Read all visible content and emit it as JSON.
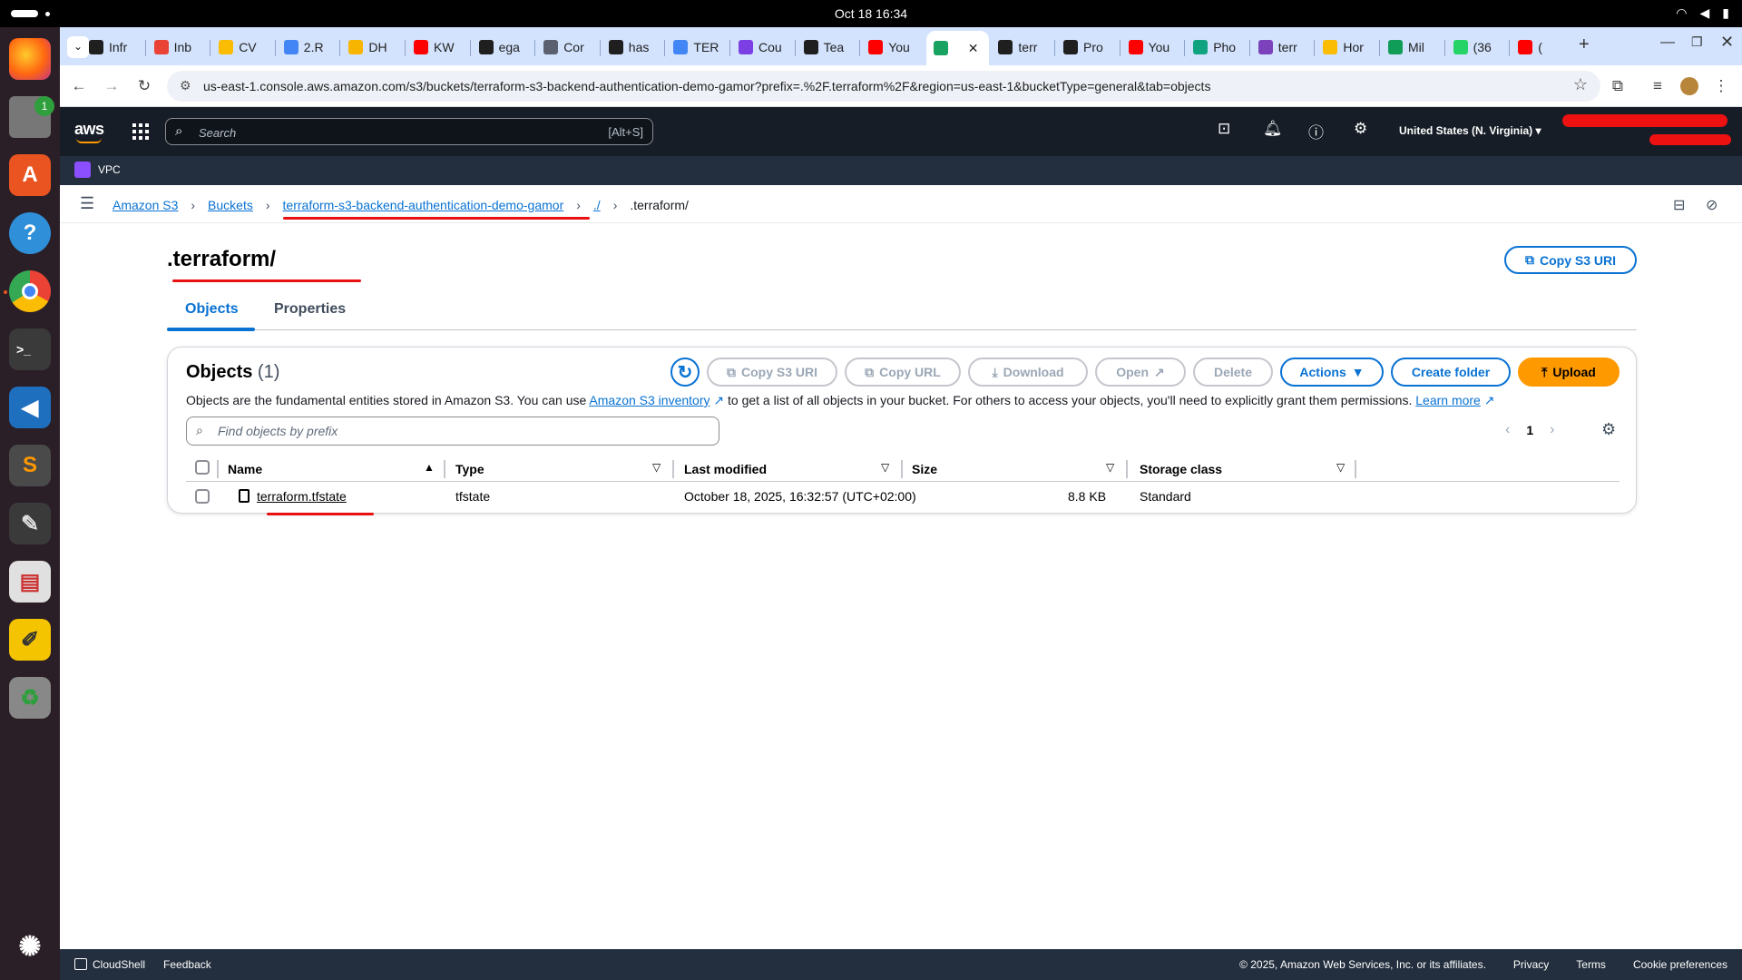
{
  "os": {
    "clock": "Oct 18  16:34",
    "dock_badge": "1",
    "dock_apps": [
      "firefox-icon",
      "files-icon",
      "app-center-icon",
      "help-icon",
      "chrome-icon",
      "terminal-icon",
      "vscode-icon",
      "sublime-icon",
      "inkscape-icon",
      "reader-icon",
      "text-editor-icon",
      "trash-icon",
      "ubuntu-icon"
    ]
  },
  "browser": {
    "tabs": [
      {
        "label": "Infr",
        "color": "#1f1f1f"
      },
      {
        "label": "Inb",
        "color": "#ea4335"
      },
      {
        "label": "CV",
        "color": "#fbbc04"
      },
      {
        "label": "2.R",
        "color": "#4285f4"
      },
      {
        "label": "DH",
        "color": "#f7b500"
      },
      {
        "label": "KW",
        "color": "#ff0000"
      },
      {
        "label": "ega",
        "color": "#1f1f1f"
      },
      {
        "label": "Cor",
        "color": "#5a6070"
      },
      {
        "label": "has",
        "color": "#1f1f1f"
      },
      {
        "label": "TER",
        "color": "#4285f4"
      },
      {
        "label": "Cou",
        "color": "#7b3fe4"
      },
      {
        "label": "Tea",
        "color": "#1f1f1f"
      },
      {
        "label": "You",
        "color": "#ff0000"
      },
      {
        "label": "",
        "color": "#1aa260"
      },
      {
        "label": "terr",
        "color": "#1f1f1f"
      },
      {
        "label": "Pro",
        "color": "#1f1f1f"
      },
      {
        "label": "You",
        "color": "#ff0000"
      },
      {
        "label": "Pho",
        "color": "#10a37f"
      },
      {
        "label": "terr",
        "color": "#7b42bc"
      },
      {
        "label": "Hor",
        "color": "#fbbc04"
      },
      {
        "label": "Mil",
        "color": "#0f9d58"
      },
      {
        "label": "(36",
        "color": "#25d366"
      },
      {
        "label": "(",
        "color": "#ff0000"
      }
    ],
    "url": "us-east-1.console.aws.amazon.com/s3/buckets/terraform-s3-backend-authentication-demo-gamor?prefix=.%2F.terraform%2F&region=us-east-1&bucketType=general&tab=objects"
  },
  "aws": {
    "logo": "aws",
    "search_placeholder": "Search",
    "search_shortcut": "[Alt+S]",
    "region": "United States (N. Virginia)",
    "service_shortcut": "VPC"
  },
  "breadcrumb": {
    "items": [
      "Amazon S3",
      "Buckets",
      "terraform-s3-backend-authentication-demo-gamor",
      "./",
      ".terraform/"
    ]
  },
  "page": {
    "title": ".terraform/",
    "copy_uri": "Copy S3 URI",
    "tabs": [
      "Objects",
      "Properties"
    ]
  },
  "objects": {
    "heading": "Objects",
    "count": "(1)",
    "desc_pre": "Objects are the fundamental entities stored in Amazon S3. You can use ",
    "desc_link": "Amazon S3 inventory",
    "desc_mid": " to get a list of all objects in your bucket. For others to access your objects, you'll need to explicitly grant them permissions. ",
    "desc_learn": "Learn more",
    "buttons": {
      "copy_uri": "Copy S3 URI",
      "copy_url": "Copy URL",
      "download": "Download",
      "open": "Open",
      "delete": "Delete",
      "actions": "Actions",
      "create_folder": "Create folder",
      "upload": "Upload"
    },
    "find_placeholder": "Find objects by prefix",
    "page": "1",
    "columns": [
      "Name",
      "Type",
      "Last modified",
      "Size",
      "Storage class"
    ],
    "rows": [
      {
        "name": "terraform.tfstate",
        "type": "tfstate",
        "modified": "October 18, 2025, 16:32:57 (UTC+02:00)",
        "size": "8.8 KB",
        "storage": "Standard"
      }
    ]
  },
  "footer": {
    "cloudshell": "CloudShell",
    "feedback": "Feedback",
    "copyright": "© 2025, Amazon Web Services, Inc. or its affiliates.",
    "privacy": "Privacy",
    "terms": "Terms",
    "cookies": "Cookie preferences"
  },
  "colors": {
    "accent": "#0972d3",
    "upload": "#ff9900",
    "nav": "#161d26",
    "annotation": "#e81010"
  }
}
